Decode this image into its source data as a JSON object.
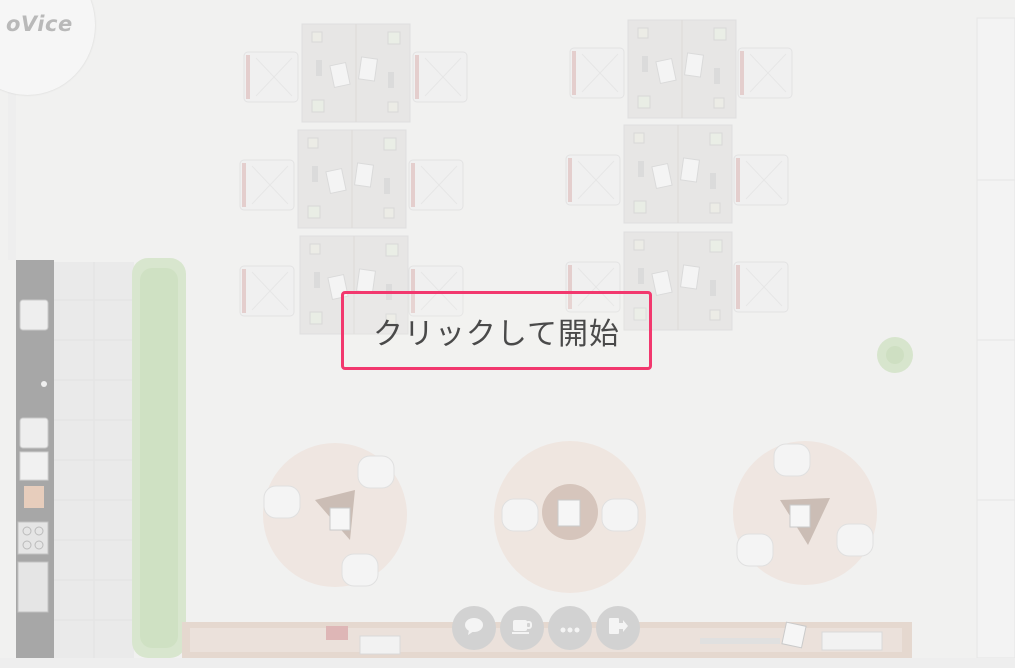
{
  "app": {
    "logo_text": "oVice"
  },
  "overlay": {
    "start_label": "クリックして開始"
  },
  "toolbar": {
    "items": [
      {
        "icon": "chat-bubble-icon"
      },
      {
        "icon": "coffee-cup-icon"
      },
      {
        "icon": "more-dots-icon"
      },
      {
        "icon": "exit-icon"
      }
    ]
  },
  "colors": {
    "accent": "#f2386e",
    "label": "#4a4a4a",
    "floor": "#f1f1f0"
  }
}
